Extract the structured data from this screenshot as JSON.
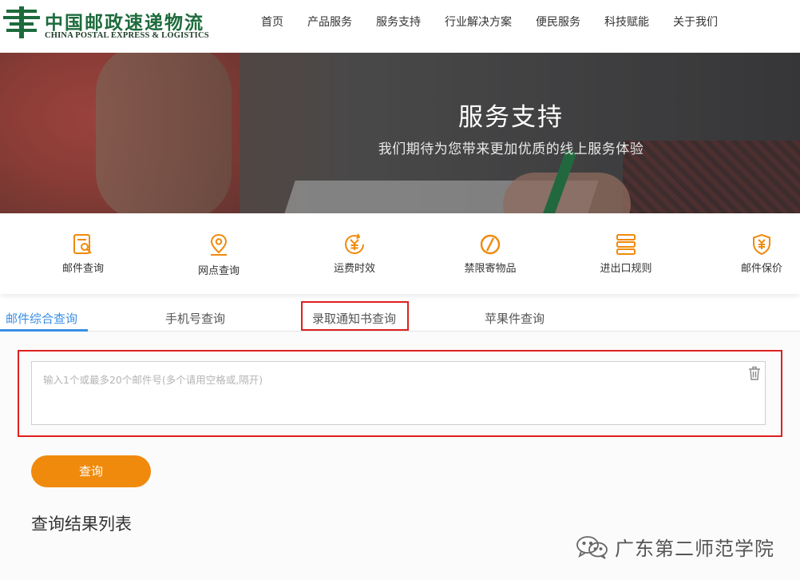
{
  "header": {
    "logo_cn": "中国邮政速递物流",
    "logo_en": "CHINA POSTAL EXPRESS & LOGISTICS",
    "nav": [
      "首页",
      "产品服务",
      "服务支持",
      "行业解决方案",
      "便民服务",
      "科技赋能",
      "关于我们"
    ]
  },
  "banner": {
    "title": "服务支持",
    "subtitle": "我们期待为您带来更加优质的线上服务体验"
  },
  "services": [
    {
      "label": "邮件查询",
      "icon": "mail-search-icon"
    },
    {
      "label": "网点查询",
      "icon": "location-pin-icon"
    },
    {
      "label": "运费时效",
      "icon": "yuan-clock-icon"
    },
    {
      "label": "禁限寄物品",
      "icon": "prohibited-icon"
    },
    {
      "label": "进出口规则",
      "icon": "rules-icon"
    },
    {
      "label": "邮件保价",
      "icon": "yuan-shield-icon"
    }
  ],
  "tabs": [
    "邮件综合查询",
    "手机号查询",
    "录取通知书查询",
    "苹果件查询"
  ],
  "active_tab": "邮件综合查询",
  "query": {
    "placeholder": "输入1个或最多20个邮件号(多个请用空格或,隔开)",
    "button_label": "查询",
    "results_title": "查询结果列表"
  },
  "watermark": {
    "text": "广东第二师范学院"
  },
  "colors": {
    "brand_green": "#1d6b3c",
    "accent_orange": "#f08a0c",
    "tab_active_blue": "#3a8ee6",
    "highlight_red": "#e02020"
  }
}
